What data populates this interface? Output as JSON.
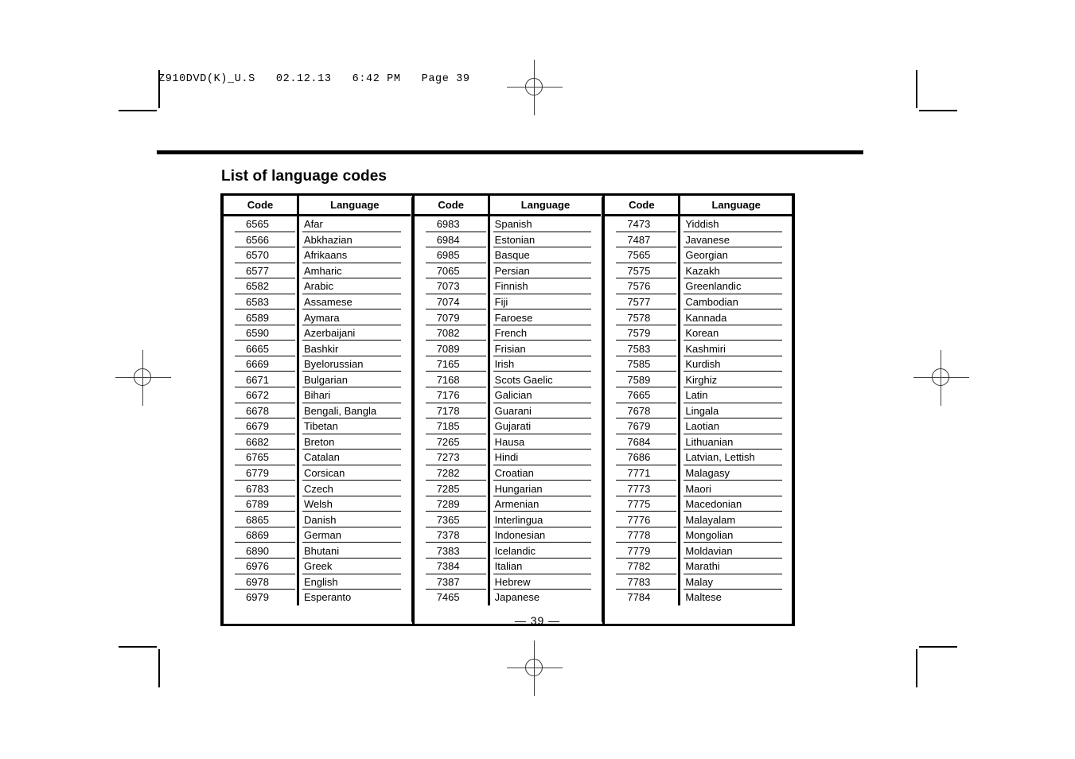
{
  "document": {
    "stamp": "Z910DVD(K)_U.S   02.12.13   6:42 PM   Page 39",
    "title": "List of language codes",
    "page_number": "— 39 —"
  },
  "table": {
    "headers": {
      "code": "Code",
      "language": "Language"
    },
    "columns": [
      {
        "rows": [
          {
            "code": "6565",
            "language": "Afar"
          },
          {
            "code": "6566",
            "language": "Abkhazian"
          },
          {
            "code": "6570",
            "language": "Afrikaans"
          },
          {
            "code": "6577",
            "language": "Amharic"
          },
          {
            "code": "6582",
            "language": "Arabic"
          },
          {
            "code": "6583",
            "language": "Assamese"
          },
          {
            "code": "6589",
            "language": "Aymara"
          },
          {
            "code": "6590",
            "language": "Azerbaijani"
          },
          {
            "code": "6665",
            "language": "Bashkir"
          },
          {
            "code": "6669",
            "language": "Byelorussian"
          },
          {
            "code": "6671",
            "language": "Bulgarian"
          },
          {
            "code": "6672",
            "language": "Bihari"
          },
          {
            "code": "6678",
            "language": "Bengali, Bangla"
          },
          {
            "code": "6679",
            "language": "Tibetan"
          },
          {
            "code": "6682",
            "language": "Breton"
          },
          {
            "code": "6765",
            "language": "Catalan"
          },
          {
            "code": "6779",
            "language": "Corsican"
          },
          {
            "code": "6783",
            "language": "Czech"
          },
          {
            "code": "6789",
            "language": "Welsh"
          },
          {
            "code": "6865",
            "language": "Danish"
          },
          {
            "code": "6869",
            "language": "German"
          },
          {
            "code": "6890",
            "language": "Bhutani"
          },
          {
            "code": "6976",
            "language": "Greek"
          },
          {
            "code": "6978",
            "language": "English"
          },
          {
            "code": "6979",
            "language": "Esperanto"
          }
        ]
      },
      {
        "rows": [
          {
            "code": "6983",
            "language": "Spanish"
          },
          {
            "code": "6984",
            "language": "Estonian"
          },
          {
            "code": "6985",
            "language": "Basque"
          },
          {
            "code": "7065",
            "language": "Persian"
          },
          {
            "code": "7073",
            "language": "Finnish"
          },
          {
            "code": "7074",
            "language": "Fiji"
          },
          {
            "code": "7079",
            "language": "Faroese"
          },
          {
            "code": "7082",
            "language": "French"
          },
          {
            "code": "7089",
            "language": "Frisian"
          },
          {
            "code": "7165",
            "language": "Irish"
          },
          {
            "code": "7168",
            "language": "Scots Gaelic"
          },
          {
            "code": "7176",
            "language": "Galician"
          },
          {
            "code": "7178",
            "language": "Guarani"
          },
          {
            "code": "7185",
            "language": "Gujarati"
          },
          {
            "code": "7265",
            "language": "Hausa"
          },
          {
            "code": "7273",
            "language": "Hindi"
          },
          {
            "code": "7282",
            "language": "Croatian"
          },
          {
            "code": "7285",
            "language": "Hungarian"
          },
          {
            "code": "7289",
            "language": "Armenian"
          },
          {
            "code": "7365",
            "language": "Interlingua"
          },
          {
            "code": "7378",
            "language": "Indonesian"
          },
          {
            "code": "7383",
            "language": "Icelandic"
          },
          {
            "code": "7384",
            "language": "Italian"
          },
          {
            "code": "7387",
            "language": "Hebrew"
          },
          {
            "code": "7465",
            "language": "Japanese"
          }
        ]
      },
      {
        "rows": [
          {
            "code": "7473",
            "language": "Yiddish"
          },
          {
            "code": "7487",
            "language": "Javanese"
          },
          {
            "code": "7565",
            "language": "Georgian"
          },
          {
            "code": "7575",
            "language": "Kazakh"
          },
          {
            "code": "7576",
            "language": "Greenlandic"
          },
          {
            "code": "7577",
            "language": "Cambodian"
          },
          {
            "code": "7578",
            "language": "Kannada"
          },
          {
            "code": "7579",
            "language": "Korean"
          },
          {
            "code": "7583",
            "language": "Kashmiri"
          },
          {
            "code": "7585",
            "language": "Kurdish"
          },
          {
            "code": "7589",
            "language": "Kirghiz"
          },
          {
            "code": "7665",
            "language": "Latin"
          },
          {
            "code": "7678",
            "language": "Lingala"
          },
          {
            "code": "7679",
            "language": "Laotian"
          },
          {
            "code": "7684",
            "language": "Lithuanian"
          },
          {
            "code": "7686",
            "language": "Latvian, Lettish"
          },
          {
            "code": "7771",
            "language": "Malagasy"
          },
          {
            "code": "7773",
            "language": "Maori"
          },
          {
            "code": "7775",
            "language": "Macedonian"
          },
          {
            "code": "7776",
            "language": "Malayalam"
          },
          {
            "code": "7778",
            "language": "Mongolian"
          },
          {
            "code": "7779",
            "language": "Moldavian"
          },
          {
            "code": "7782",
            "language": "Marathi"
          },
          {
            "code": "7783",
            "language": "Malay"
          },
          {
            "code": "7784",
            "language": "Maltese"
          }
        ]
      }
    ]
  }
}
